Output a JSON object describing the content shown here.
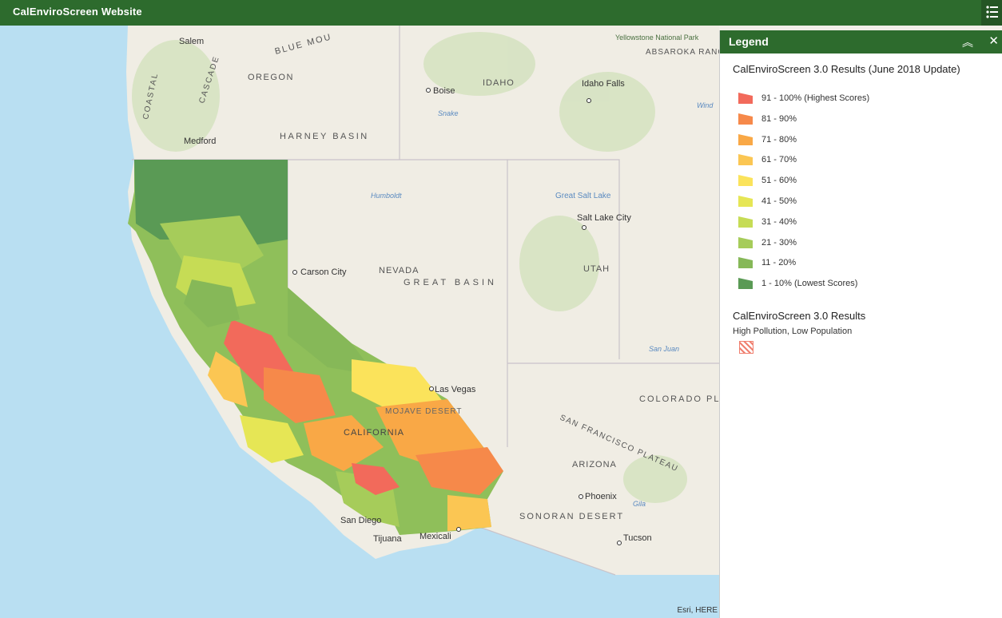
{
  "app": {
    "title": "CalEnviroScreen Website"
  },
  "legend": {
    "title": "Legend",
    "collapse_icon": "︽",
    "close_icon": "✕",
    "layer1_title": "CalEnviroScreen 3.0 Results (June 2018 Update)",
    "items": [
      {
        "label": "91 - 100% (Highest Scores)",
        "color": "#f26a5b"
      },
      {
        "label": "81 - 90%",
        "color": "#f6894a"
      },
      {
        "label": "71 - 80%",
        "color": "#f9a846"
      },
      {
        "label": "61 - 70%",
        "color": "#fbc653"
      },
      {
        "label": "51 - 60%",
        "color": "#fbe35b"
      },
      {
        "label": "41 - 50%",
        "color": "#e6e655"
      },
      {
        "label": "31 - 40%",
        "color": "#c6dc55"
      },
      {
        "label": "21 - 30%",
        "color": "#a6cc5a"
      },
      {
        "label": "11 - 20%",
        "color": "#86b858"
      },
      {
        "label": "1 - 10% (Lowest Scores)",
        "color": "#5a9a55"
      }
    ],
    "layer2_title": "CalEnviroScreen 3.0 Results",
    "layer2_sublabel": "High Pollution, Low Population"
  },
  "map": {
    "attribution": "Esri, HERE",
    "labels": {
      "salem": "Salem",
      "oregon": "OREGON",
      "coastal": "COASTAL",
      "cascade": "CASCADE",
      "blue_mountains": "BLUE MOU",
      "harney_basin": "HARNEY BASIN",
      "medford": "Medford",
      "boise": "Boise",
      "idaho": "IDAHO",
      "idaho_falls": "Idaho Falls",
      "yellowstone": "Yellowstone National Park",
      "absaroka": "ABSAROKA RANGE",
      "great_salt_lake": "Great Salt Lake",
      "salt_lake_city": "Salt Lake City",
      "nevada": "NEVADA",
      "great_basin": "GREAT BASIN",
      "carson_city": "Carson City",
      "utah": "UTAH",
      "las_vegas": "Las Vegas",
      "colorado_plateau": "COLORADO PLATEAU",
      "california": "CALIFORNIA",
      "mojave": "MOJAVE DESERT",
      "arizona": "ARIZONA",
      "phoenix": "Phoenix",
      "sonoran": "SONORAN DESERT",
      "tucson": "Tucson",
      "san_diego": "San Diego",
      "tijuana": "Tijuana",
      "mexicali": "Mexicali",
      "san_juan": "San Juan",
      "snake": "Snake",
      "humboldt": "Humboldt",
      "wind": "Wind",
      "gila": "Gila",
      "san_francisco_plateau": "SAN FRANCISCO PLATEAU"
    }
  }
}
